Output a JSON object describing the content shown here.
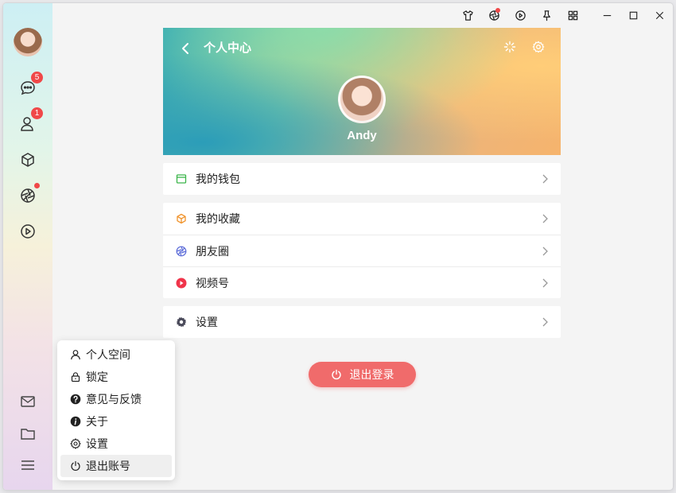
{
  "sidebar": {
    "top": [
      {
        "name": "chat",
        "icon": "chat-bubble-icon",
        "badge": "5"
      },
      {
        "name": "contacts",
        "icon": "contacts-icon",
        "badge": "1"
      },
      {
        "name": "favorites",
        "icon": "cube-icon",
        "badge": ""
      },
      {
        "name": "moments",
        "icon": "aperture-icon",
        "dot": true
      },
      {
        "name": "channels",
        "icon": "play-circle-icon",
        "badge": ""
      }
    ],
    "bottom": [
      {
        "name": "mail",
        "icon": "mail-icon"
      },
      {
        "name": "folder",
        "icon": "folder-icon"
      },
      {
        "name": "menu",
        "icon": "hamburger-menu-icon"
      }
    ]
  },
  "titlebar": {
    "icons": [
      "shirt-icon",
      "aperture-icon",
      "play-circle-icon",
      "pin-icon",
      "grid-icon",
      "minimize-icon",
      "maximize-icon",
      "close-icon"
    ]
  },
  "profile": {
    "title": "个人中心",
    "name": "Andy"
  },
  "menu_groups": [
    [
      {
        "label": "我的钱包",
        "icon": "wallet-icon",
        "color": "#3bb54a"
      }
    ],
    [
      {
        "label": "我的收藏",
        "icon": "cube-icon",
        "color": "#f0932b"
      },
      {
        "label": "朋友圈",
        "icon": "aperture-icon",
        "color": "#5b6bd8"
      },
      {
        "label": "视频号",
        "icon": "play-circle-icon",
        "color": "#f0344a"
      }
    ],
    [
      {
        "label": "设置",
        "icon": "gear-icon",
        "color": "#4a4a5a"
      }
    ]
  ],
  "logout_button": "退出登录",
  "popup_menu": [
    {
      "label": "个人空间",
      "icon": "user-icon"
    },
    {
      "label": "锁定",
      "icon": "lock-icon"
    },
    {
      "label": "意见与反馈",
      "icon": "question-icon"
    },
    {
      "label": "关于",
      "icon": "info-icon"
    },
    {
      "label": "设置",
      "icon": "gear-icon"
    },
    {
      "label": "退出账号",
      "icon": "power-icon"
    }
  ],
  "colors": {
    "accent_red": "#f06b6b",
    "badge": "#f04848"
  }
}
